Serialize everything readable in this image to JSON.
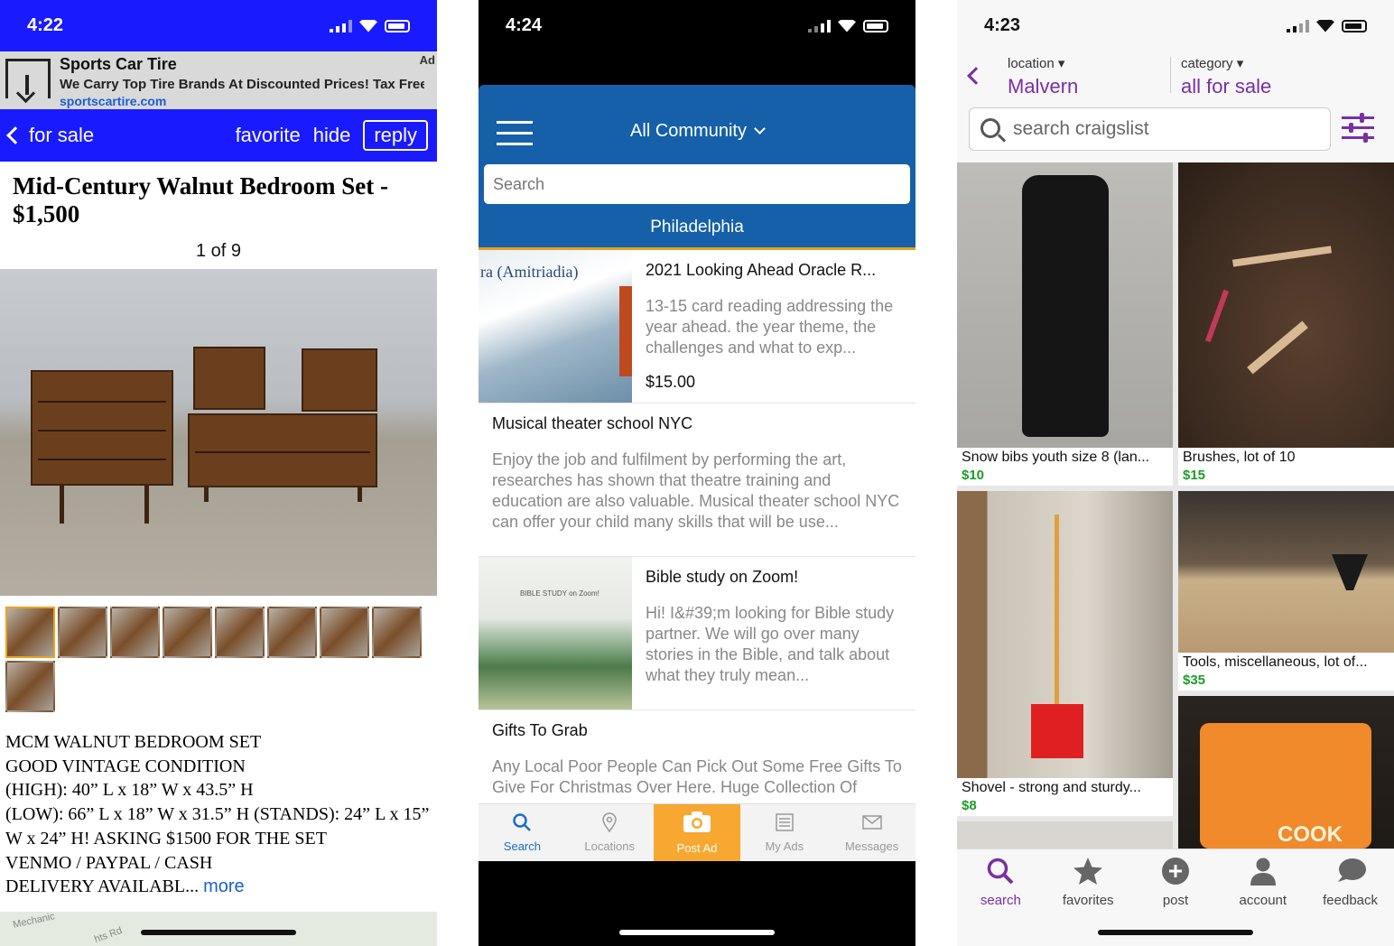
{
  "phone1": {
    "status": {
      "time": "4:22"
    },
    "ad": {
      "title": "Sports Car Tire",
      "desc": "We Carry Top Tire Brands At Discounted Prices! Tax Free D...",
      "url": "sportscartire.com",
      "badge": "Ad"
    },
    "nav": {
      "back": "for sale",
      "favorite": "favorite",
      "hide": "hide",
      "reply": "reply"
    },
    "title": "Mid-Century Walnut Bedroom Set - $1,500",
    "counter": "1 of 9",
    "desc_lines": [
      "MCM WALNUT BEDROOM SET",
      "GOOD VINTAGE CONDITION",
      "(HIGH): 40” L x 18” W x 43.5” H",
      "(LOW): 66” L x 18” W x 31.5” H (STANDS): 24” L x 15” W x 24” H! ASKING $1500 FOR THE SET",
      "VENMO / PAYPAL / CASH",
      "DELIVERY AVAILABL..."
    ],
    "more": "more",
    "map_labels": {
      "street1": "Mechanic",
      "street2": "hts Rd"
    }
  },
  "phone2": {
    "status": {
      "time": "4:24"
    },
    "community": "All Community",
    "search_placeholder": "Search",
    "city": "Philadelphia",
    "listings": [
      {
        "title": "2021 Looking Ahead Oracle R...",
        "text": "13-15 card reading addressing the year ahead. the year theme, the challenges and what to exp...",
        "price": "$15.00",
        "img_text": "ra (Amitriadia)"
      },
      {
        "title": "Musical theater school NYC",
        "text": "Enjoy the job and fulfilment by performing the art, researches has shown that theatre training and education are also valuable. Musical theater school NYC can offer your child many skills that will be use..."
      },
      {
        "title": "Bible study on Zoom!",
        "text": "Hi! I&#39;m looking for Bible study partner. We will go over many stories in the Bible, and talk about what they truly mean...",
        "img_text": "BIBLE STUDY on Zoom!"
      },
      {
        "title": "Gifts To Grab",
        "text": "Any Local Poor People Can Pick Out Some Free Gifts To Give For Christmas Over Here. Huge Collection Of"
      }
    ],
    "tabs": [
      {
        "label": "Search",
        "icon": "search-icon"
      },
      {
        "label": "Locations",
        "icon": "location-pin-icon"
      },
      {
        "label": "Post Ad",
        "icon": "camera-icon"
      },
      {
        "label": "My Ads",
        "icon": "list-icon"
      },
      {
        "label": "Messages",
        "icon": "envelope-icon"
      }
    ],
    "colors": {
      "header": "#1560a8",
      "post_tab": "#f7a830",
      "active": "#1a6fc4"
    }
  },
  "phone3": {
    "status": {
      "time": "4:23"
    },
    "location": {
      "label": "location",
      "value": "Malvern"
    },
    "category": {
      "label": "category",
      "value": "all for sale"
    },
    "search_placeholder": "search craigslist",
    "cards": [
      {
        "title": "Snow bibs youth size 8 (lan...",
        "price": "$10"
      },
      {
        "title": "Brushes, lot of 10",
        "price": "$15"
      },
      {
        "title": "Shovel - strong and sturdy...",
        "price": "$8"
      },
      {
        "title": "Tools, miscellaneous, lot of...",
        "price": "$35"
      },
      {
        "title": "",
        "price": "",
        "img_text": "COOK"
      }
    ],
    "tabs": [
      {
        "label": "search",
        "icon": "search-icon"
      },
      {
        "label": "favorites",
        "icon": "star-icon"
      },
      {
        "label": "post",
        "icon": "plus-circle-icon"
      },
      {
        "label": "account",
        "icon": "person-icon"
      },
      {
        "label": "feedback",
        "icon": "chat-bubble-icon"
      }
    ],
    "colors": {
      "accent": "#7a2fa4",
      "price": "#1c9c2a"
    }
  }
}
